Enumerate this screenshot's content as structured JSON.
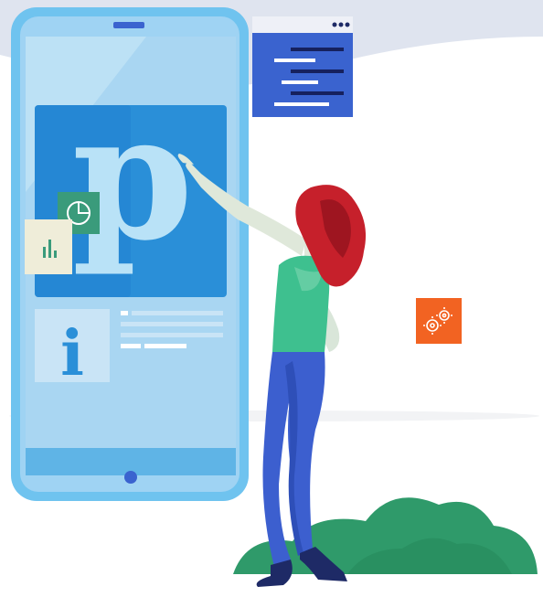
{
  "app_glyphs": {
    "main_letter": "p",
    "info_letter": "i"
  },
  "colors": {
    "background_arc": "#dfe4ef",
    "phone_frame": "#6fc3ef",
    "phone_screen": "#a9d6f2",
    "tile_blue": "#2a8fd8",
    "letter_fill": "#b9e2f7",
    "code_window": "#3a63cf",
    "settings_tile": "#f26322",
    "chart_tile_green": "#3a9b7b",
    "chart_tile_cream": "#efedd9",
    "hair_red": "#c6202b",
    "shirt_green": "#3ec08f",
    "jeans_blue": "#3c5fcf",
    "shoes_navy": "#1e2a66",
    "bush_green": "#2f9a6a"
  },
  "icons": {
    "code_window": "code-editor-window-icon",
    "settings": "gears-icon",
    "pie_chart": "pie-chart-icon",
    "bar_chart": "bar-chart-icon",
    "info": "info-icon"
  }
}
